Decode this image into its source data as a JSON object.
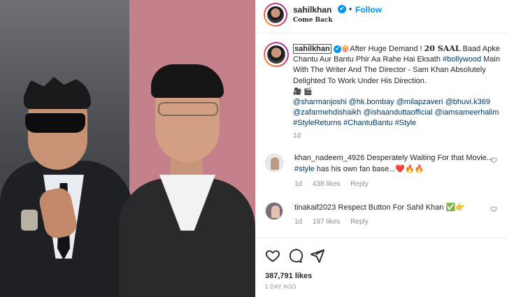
{
  "post": {
    "username": "sahilkhan",
    "verified_glyph": "✔",
    "dot": "•",
    "follow_label": "Follow",
    "subtitle": "Come Back"
  },
  "caption": {
    "username": "sahilkhan",
    "emoji_start": "🍿",
    "text_a": "After Huge Demand ! ",
    "bold": "20 SAAL",
    "text_b": " Baad Apke Chantu Aur Bantu Phir Aa Rahe Hai Eksath ",
    "tag_bollywood": "#bollywood",
    "text_c": " Main With The Writer And The Director - Sam Khan Absolutely Delighted To Work Under His Direction.",
    "emoji_line": "🎥 🎬",
    "mentions": [
      "@sharmanjoshi",
      "@hk.bombay",
      "@milapzaveri",
      "@bhuvi.k369",
      "@zafarmehdishaikh",
      "@ishaanduttaofficial",
      "@iamsameerhalim"
    ],
    "hashtags": [
      "#StyleReturns",
      "#ChantuBantu",
      "#Style"
    ],
    "time": "1d"
  },
  "comments": [
    {
      "user": "khan_nadeem_4926",
      "text_a": "Desperately Waiting For that Movie...",
      "tag": "#style",
      "text_b": " has his own fan base...",
      "emoji": "❤️🔥🔥",
      "time": "1d",
      "likes": "438 likes",
      "reply": "Reply"
    },
    {
      "user": "tinakaif2023",
      "text_a": "Respect Button For Sahil Khan",
      "emoji": "✅👉",
      "time": "1d",
      "likes": "197 likes",
      "reply": "Reply"
    }
  ],
  "footer": {
    "likes": "387,791 likes",
    "ago": "1 DAY AGO"
  },
  "icons": {
    "like": "heart-icon",
    "comment": "comment-icon",
    "share": "share-icon"
  },
  "colors": {
    "accent": "#0095f6",
    "tag": "#00376b",
    "muted": "#8e8e8e",
    "text": "#262626"
  }
}
